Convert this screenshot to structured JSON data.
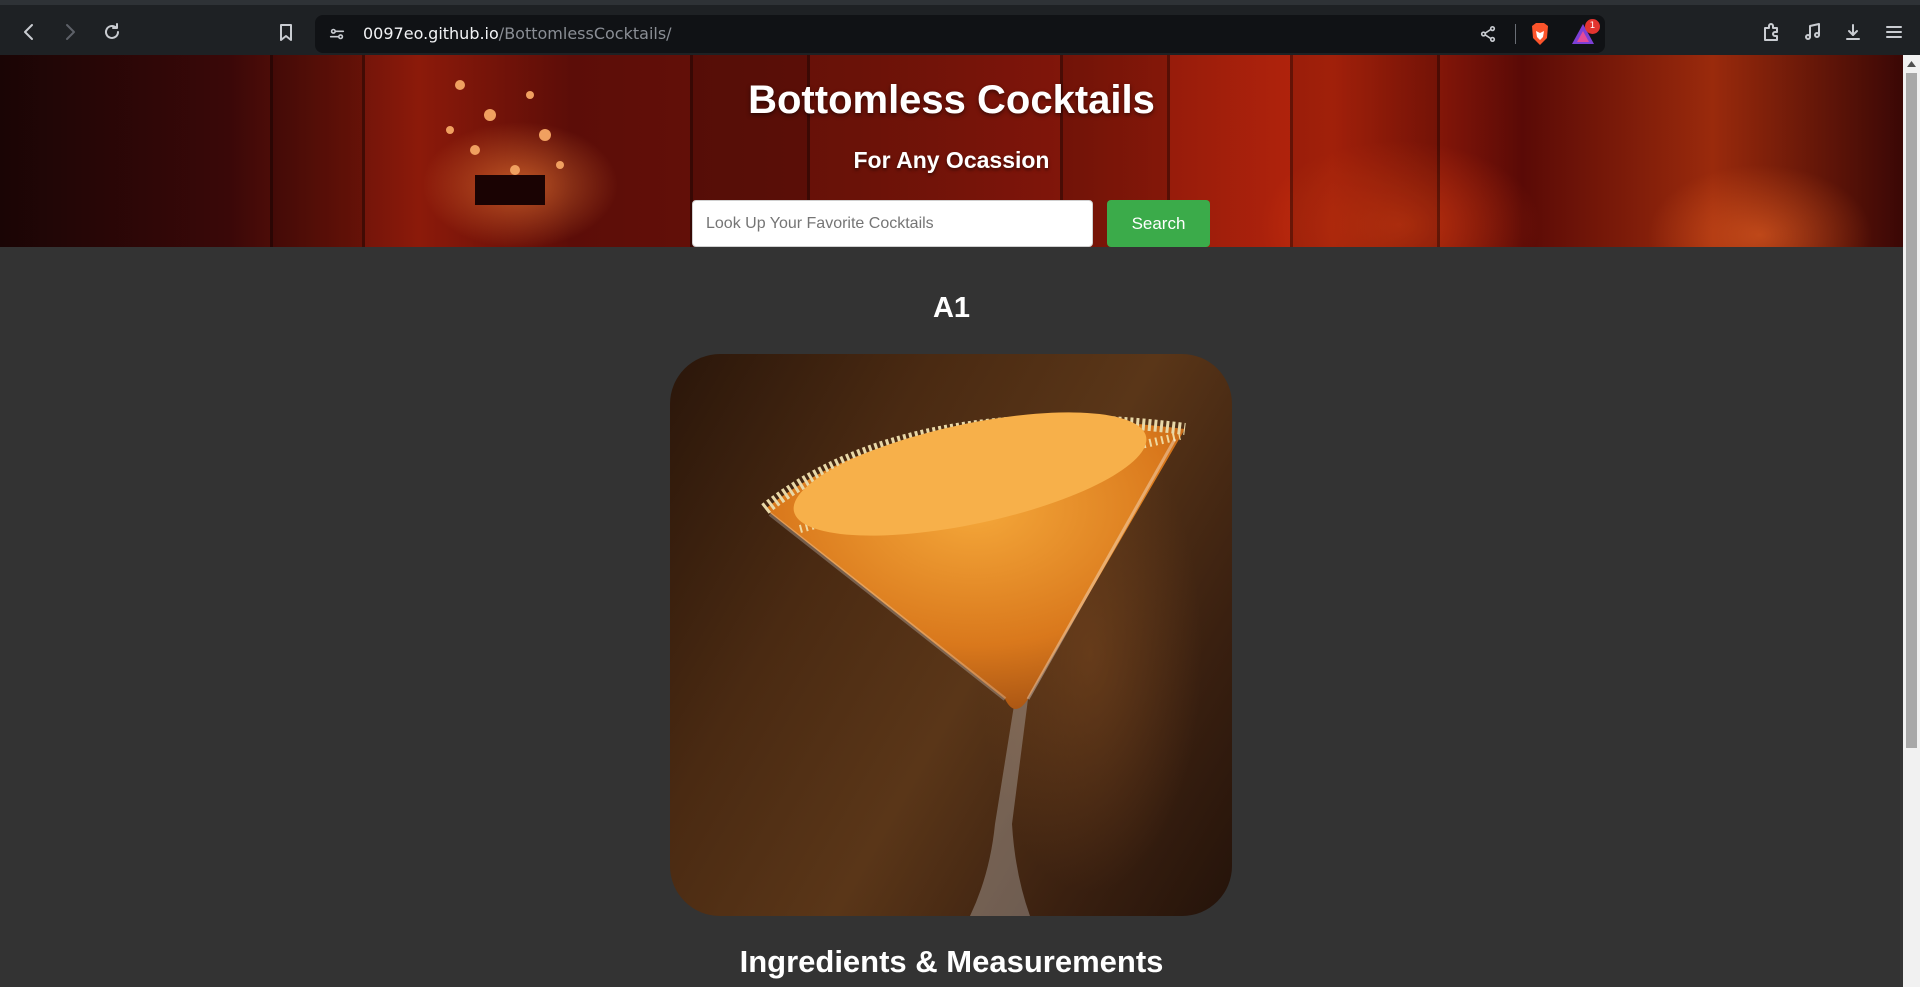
{
  "browser": {
    "url_host": "0097eo.github.io",
    "url_path": "/BottomlessCocktails/",
    "rewards_badge": "1",
    "icons": [
      "back-icon",
      "forward-icon",
      "reload-icon",
      "bookmark-icon",
      "site-settings-icon",
      "share-icon",
      "brave-shields-icon",
      "brave-rewards-icon",
      "extensions-icon",
      "media-icon",
      "downloads-icon",
      "menu-icon"
    ]
  },
  "hero": {
    "title": "Bottomless Cocktails",
    "subtitle": "For Any Ocassion",
    "search_placeholder": "Look Up Your Favorite Cocktails",
    "search_button": "Search"
  },
  "drink": {
    "name": "A1",
    "image_alt": "A1 cocktail",
    "ingredients_heading": "Ingredients & Measurements"
  },
  "colors": {
    "background": "#333333",
    "search_button": "#3bab4a",
    "text": "#ffffff"
  }
}
